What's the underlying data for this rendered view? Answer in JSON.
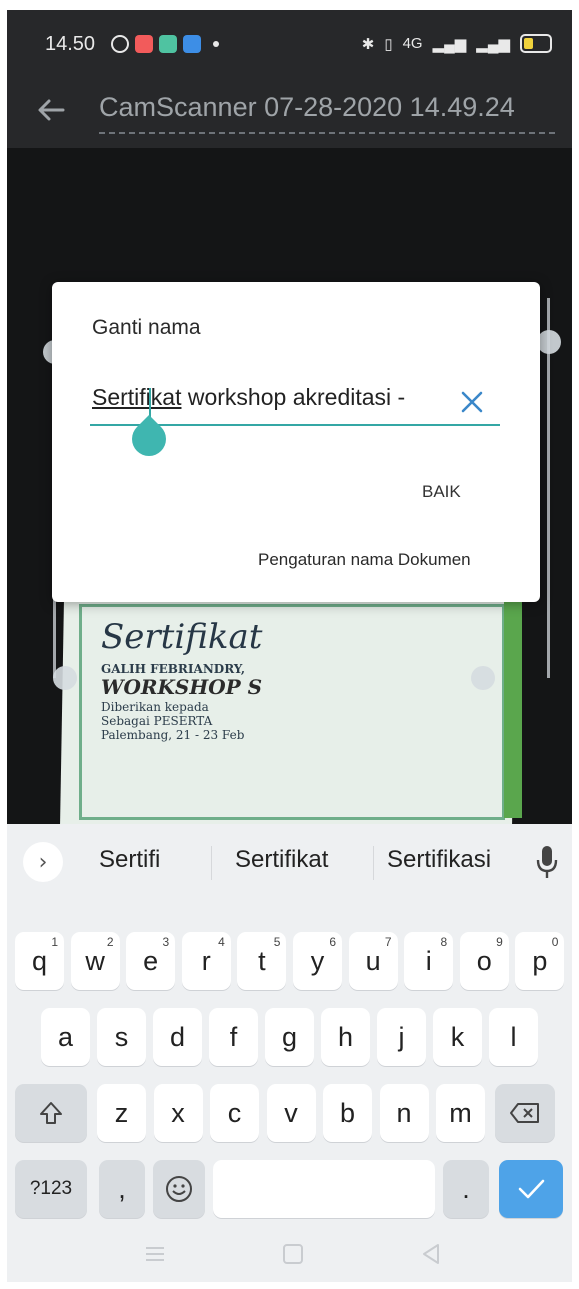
{
  "status": {
    "time": "14.50",
    "right_text": "4G"
  },
  "appbar": {
    "doc_title": "CamScanner 07-28-2020 14.49.24"
  },
  "preview": {
    "lines": [
      "Sertifikat",
      "GALIH FEBRIANDRY,",
      "WORKSHOP S",
      "Diberikan kepada",
      "Sebagai PESERTA",
      "Palembang, 21 - 23 Feb"
    ]
  },
  "dialog": {
    "title": "Ganti nama",
    "input_first_word": "Sertifikat",
    "input_rest": " workshop akreditasi -",
    "ok_label": "BAIK",
    "settings_link": "Pengaturan nama Dokumen"
  },
  "keyboard": {
    "suggestions": [
      "Sertifi",
      "Sertifikat",
      "Sertifikasi"
    ],
    "row1": [
      {
        "k": "q",
        "h": "1"
      },
      {
        "k": "w",
        "h": "2"
      },
      {
        "k": "e",
        "h": "3"
      },
      {
        "k": "r",
        "h": "4"
      },
      {
        "k": "t",
        "h": "5"
      },
      {
        "k": "y",
        "h": "6"
      },
      {
        "k": "u",
        "h": "7"
      },
      {
        "k": "i",
        "h": "8"
      },
      {
        "k": "o",
        "h": "9"
      },
      {
        "k": "p",
        "h": "0"
      }
    ],
    "row2": [
      "a",
      "s",
      "d",
      "f",
      "g",
      "h",
      "j",
      "k",
      "l"
    ],
    "row3": [
      "z",
      "x",
      "c",
      "v",
      "b",
      "n",
      "m"
    ],
    "sym_label": "?123",
    "comma": ",",
    "period": "."
  }
}
